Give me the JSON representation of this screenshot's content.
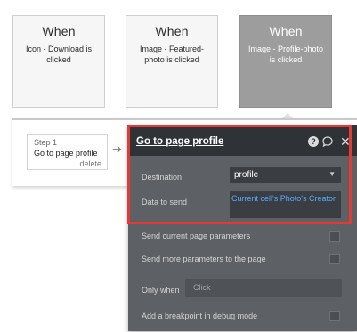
{
  "events": [
    {
      "title": "When",
      "description": "Icon - Download is clicked",
      "selected": false
    },
    {
      "title": "When",
      "description": "Image - Featured-photo is clicked",
      "selected": false
    },
    {
      "title": "When",
      "description": "Image - Profile-photo is clicked",
      "selected": true
    }
  ],
  "step": {
    "number": "Step 1",
    "name": "Go to page profile",
    "delete_label": "delete"
  },
  "panel": {
    "title": "Go to page profile",
    "icons": [
      "help-icon",
      "comment-icon",
      "close-icon"
    ],
    "destination_label": "Destination",
    "destination_value": "profile",
    "data_to_send_label": "Data to send",
    "data_to_send_value": "Current cell's Photo's Creator",
    "send_current_params_label": "Send current page parameters",
    "send_more_params_label": "Send more parameters to the page",
    "only_when_label": "Only when",
    "only_when_placeholder": "Click",
    "breakpoint_label": "Add a breakpoint in debug mode"
  },
  "colors": {
    "highlight": "#e53935",
    "selected_card": "#9d9d9d",
    "panel_bg": "#5d6064",
    "dynamic_text": "#5aa9ff"
  }
}
